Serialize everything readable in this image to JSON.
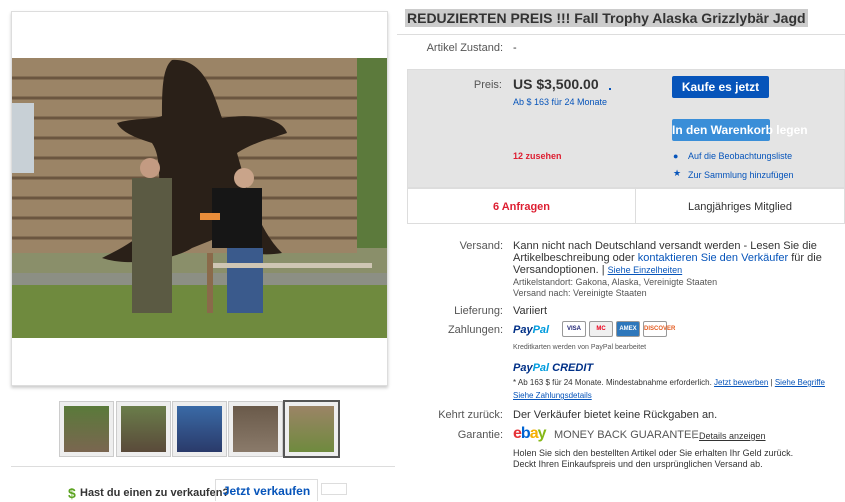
{
  "listing": {
    "title": "REDUZIERTEN PREIS !!! Fall Trophy Alaska Grizzlybär Jagd",
    "condition_label": "Artikel Zustand:",
    "condition_value": "-"
  },
  "price": {
    "label": "Preis:",
    "amount": "US $3,500.00",
    "installment": "Ab $ 163 für 24 Monate",
    "watchers": "12 zusehen",
    "buy_now": "Kaufe es jetzt",
    "add_to_cart": "In den Warenkorb legen",
    "watchlist": "Auf die Beobachtungsliste",
    "collection": "Zur Sammlung hinzufügen",
    "inquiries": "6 Anfragen",
    "member": "Langjähriges Mitglied"
  },
  "shipping": {
    "label": "Versand:",
    "text1": "Kann nicht nach Deutschland versandt werden - Lesen Sie die Artikelbeschreibung oder ",
    "link": "kontaktieren Sie den Verkäufer",
    "text2": " für die Versandoptionen.",
    "details_link": "Siehe Einzelheiten",
    "location": "Artikelstandort:  Gakona, Alaska, Vereinigte Staaten",
    "ships_to": "Versand nach:  Vereinigte Staaten"
  },
  "delivery": {
    "label": "Lieferung:",
    "value": "Variiert"
  },
  "payments": {
    "label": "Zahlungen:",
    "paypal_note": "Kreditkarten werden von PayPal bearbeitet",
    "credit_note": "* Ab 163 $ für 24 Monate. Mindestabnahme erforderlich.",
    "apply_link": "Jetzt bewerben",
    "terms_link": "Siehe Begriffe",
    "details_link": "Siehe Zahlungsdetails",
    "cards": [
      "VISA",
      "MC",
      "AMEX",
      "DISCOVER"
    ]
  },
  "returns": {
    "label": "Kehrt zurück:",
    "value": "Der Verkäufer bietet keine Rückgaben an."
  },
  "guarantee": {
    "label": "Garantie:",
    "title": "MONEY BACK GUARANTEE",
    "details_link": "Details anzeigen",
    "text": "Holen Sie sich den bestellten Artikel oder Sie erhalten Ihr Geld zurück.",
    "text2": "Deckt Ihren Einkaufspreis und den ursprünglichen Versand ab."
  },
  "sell": {
    "question": "Hast du einen zu verkaufen?",
    "button": "Jetzt verkaufen"
  },
  "colors": {
    "accent": "#0654ba",
    "watchers": "#dd1e31",
    "paypal": "#003087"
  }
}
